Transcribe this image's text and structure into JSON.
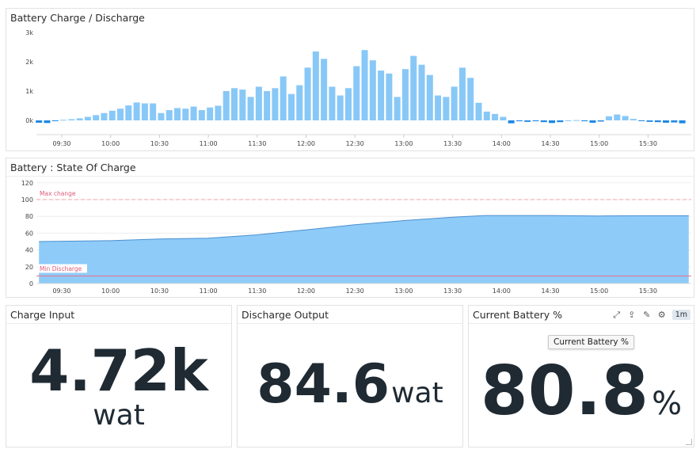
{
  "colors": {
    "bar": "#88c8f7",
    "bar_neg": "#1e88e5",
    "area": "#8ecbf8",
    "area_line": "#4a8fd0",
    "max_line": "#f2a3a3",
    "min_line": "#e8728a",
    "marker_text": "#e05a78",
    "grid": "#eeeeee"
  },
  "charge_panel": {
    "title": "Battery Charge / Discharge"
  },
  "soc_panel": {
    "title": "Battery : State Of Charge"
  },
  "charge_input": {
    "title": "Charge Input",
    "value": "4.72k",
    "unit": "wat"
  },
  "discharge_output": {
    "title": "Discharge Output",
    "value": "84.6",
    "unit": "wat"
  },
  "current_battery": {
    "title": "Current Battery %",
    "value": "80.8",
    "unit": "%",
    "tooltip": "Current Battery %",
    "timeframe": "1m",
    "icons": [
      "expand-icon",
      "share-icon",
      "edit-icon",
      "gear-icon"
    ]
  },
  "chart_data": [
    {
      "type": "bar",
      "title": "Battery Charge / Discharge",
      "x_ticks": [
        "09:30",
        "10:00",
        "10:30",
        "11:00",
        "11:30",
        "12:00",
        "12:30",
        "13:00",
        "13:30",
        "14:00",
        "14:30",
        "15:00",
        "15:30"
      ],
      "y_ticks": [
        "0k",
        "1k",
        "2k",
        "3k"
      ],
      "ylim": [
        -200,
        3000
      ],
      "start": "09:16",
      "interval_minutes": 5,
      "values": [
        -80,
        -90,
        -10,
        20,
        40,
        70,
        120,
        180,
        250,
        330,
        400,
        510,
        610,
        580,
        580,
        250,
        350,
        420,
        400,
        470,
        350,
        440,
        500,
        1000,
        1100,
        1050,
        800,
        1150,
        1000,
        1100,
        1500,
        900,
        1200,
        1800,
        2350,
        2100,
        1150,
        850,
        1100,
        1850,
        2400,
        2050,
        1700,
        1600,
        800,
        1750,
        2200,
        1900,
        1550,
        850,
        800,
        1150,
        1800,
        1450,
        600,
        300,
        220,
        120,
        -100,
        -30,
        -50,
        -30,
        -60,
        -90,
        -60,
        0,
        10,
        -30,
        -80,
        -40,
        140,
        200,
        150,
        50,
        -20,
        -50,
        -60,
        -80,
        -70,
        -100
      ]
    },
    {
      "type": "area",
      "title": "Battery : State Of Charge",
      "x_ticks": [
        "09:30",
        "10:00",
        "10:30",
        "11:00",
        "11:30",
        "12:00",
        "12:30",
        "13:00",
        "13:30",
        "14:00",
        "14:30",
        "15:00",
        "15:30"
      ],
      "y_ticks": [
        "0",
        "20",
        "40",
        "60",
        "80",
        "100",
        "120"
      ],
      "ylim": [
        0,
        120
      ],
      "x": [
        "09:16",
        "10:00",
        "10:30",
        "11:00",
        "11:30",
        "12:00",
        "12:30",
        "13:00",
        "13:30",
        "13:50",
        "14:30",
        "15:00",
        "15:30",
        "15:55"
      ],
      "y": [
        50,
        51,
        53,
        54,
        58,
        64,
        70,
        75,
        79,
        81,
        81,
        80.5,
        80.8,
        80.8
      ],
      "thresholds": [
        {
          "label": "Max change",
          "value": 100,
          "style": "dashed"
        },
        {
          "label": "Min Discharge",
          "value": 9,
          "style": "solid"
        }
      ]
    }
  ]
}
